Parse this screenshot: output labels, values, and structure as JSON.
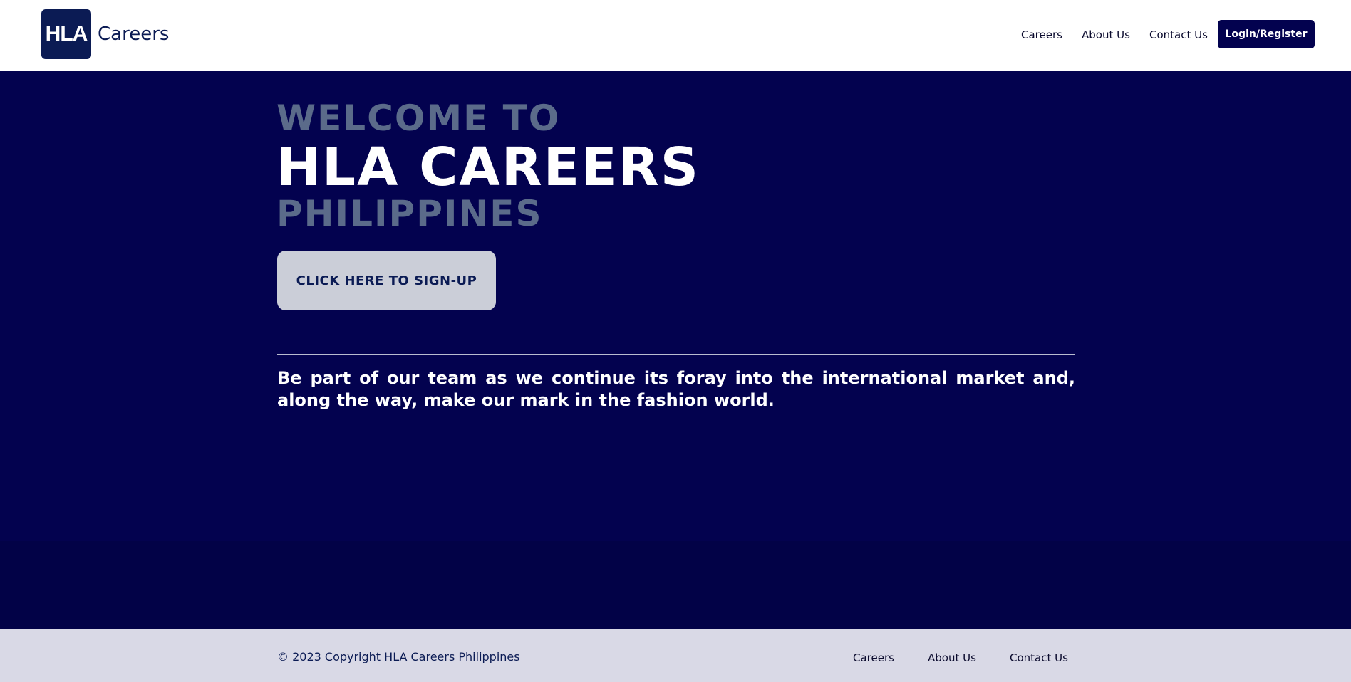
{
  "header": {
    "logo_badge": "HLA",
    "logo_text": "Careers",
    "nav": {
      "careers": "Careers",
      "about": "About Us",
      "contact": "Contact Us"
    },
    "login_label": "Login/Register"
  },
  "hero": {
    "welcome": "WELCOME TO",
    "title": "HLA CAREERS",
    "subtitle": "PHILIPPINES",
    "signup_label": "CLICK HERE TO SIGN-UP",
    "tagline": "Be part of our team as we continue its foray into the international market and, along the way, make our mark in the fashion world."
  },
  "footer": {
    "copyright": "© 2023 Copyright HLA Careers Philippines",
    "links": {
      "careers": "Careers",
      "about": "About Us",
      "contact": "Contact Us"
    }
  },
  "colors": {
    "navy": "#03024f",
    "brand": "#0b1b54",
    "muted_heading": "#5b6b8a",
    "button_light": "#cbced8",
    "footer_bg": "#d9d9e6"
  }
}
